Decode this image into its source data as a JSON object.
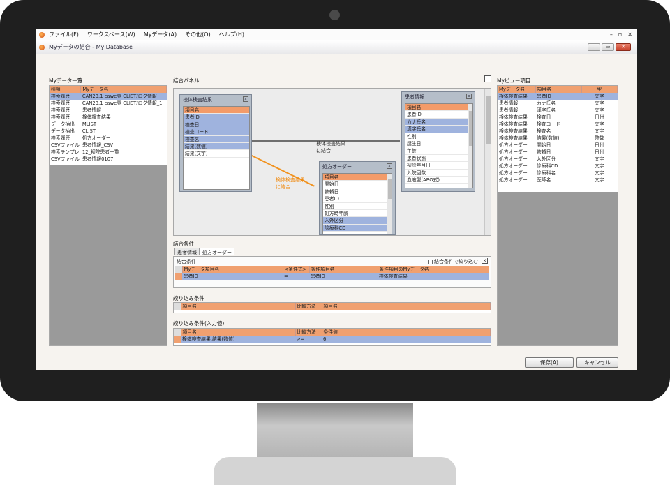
{
  "menu": {
    "items": [
      "ファイル(F)",
      "ワークスペース(W)",
      "Myデータ(A)",
      "その他(O)",
      "ヘルプ(H)"
    ],
    "controls": [
      "–",
      "▫",
      "✕"
    ]
  },
  "window": {
    "title": "Myデータの結合 - My Database",
    "buttons": [
      "–",
      "▭",
      "✕"
    ]
  },
  "mydata_list": {
    "label": "Myデータ一覧",
    "columns": [
      "種類",
      "Myデータ名"
    ],
    "rows": [
      [
        "検索履歴",
        "CAN23.1 cawe登 CLIST/ログ情報"
      ],
      [
        "検索履歴",
        "CAN23.1 cawe登 CLIST/ログ情報_1"
      ],
      [
        "検索履歴",
        "患者情報"
      ],
      [
        "検索履歴",
        "検体検査結果"
      ],
      [
        "データ抽出",
        "MLIST"
      ],
      [
        "データ抽出",
        "CLIST"
      ],
      [
        "検索履歴",
        "処方オーダー"
      ],
      [
        "CSVファイル",
        "患者情報_CSV"
      ],
      [
        "検索テンプレ",
        "12_初院患者一覧"
      ],
      [
        "CSVファイル",
        "患者情報0107"
      ]
    ],
    "selected_index": 0
  },
  "join_panel": {
    "label": "結合パネル",
    "join_label_top": "検体検査結果\nに結合",
    "join_label_left": "検体検査結果\nに結合",
    "tables": {
      "kentai": {
        "title": "検体検査結果",
        "fields": [
          "項目名",
          "患者ID",
          "検査日",
          "検査コード",
          "検査名",
          "結果(数値)",
          "結果(文字)"
        ]
      },
      "kanja": {
        "title": "患者情報",
        "fields": [
          "項目名",
          "患者ID",
          "カナ氏名",
          "漢字氏名",
          "性別",
          "誕生日",
          "年齢",
          "患者状態",
          "初診年月日",
          "入院回数",
          "血液型(ABO式)"
        ]
      },
      "shohou": {
        "title": "処方オーダー",
        "fields": [
          "項目名",
          "開始日",
          "依頼日",
          "患者ID",
          "性別",
          "処方時年齢",
          "入外区分",
          "診療科CD"
        ]
      }
    }
  },
  "join_conditions": {
    "label": "結合条件",
    "tabs": [
      "患者情報",
      "処方オーダー"
    ],
    "inner_label": "結合条件",
    "checkbox_label": "結合条件で絞り込む",
    "columns": [
      "Myデータ項目名",
      "<条件式>",
      "条件項目名",
      "条件項目のMyデータ名"
    ],
    "rows": [
      [
        "患者ID",
        "=",
        "患者ID",
        "検体検査結果"
      ]
    ]
  },
  "filter": {
    "label": "絞り込み条件",
    "columns": [
      "項目名",
      "比較方法",
      "項目名"
    ]
  },
  "filter_input": {
    "label": "絞り込み条件(入力値)",
    "columns": [
      "項目名",
      "比較方法",
      "条件値"
    ],
    "rows": [
      [
        "検体検査結果.結果(数値)",
        ">=",
        "6"
      ]
    ]
  },
  "myview": {
    "label": "Myビュー項目",
    "columns": [
      "Myデータ名",
      "項目名",
      "型"
    ],
    "rows": [
      [
        "検体検査結果",
        "患者ID",
        "文字"
      ],
      [
        "患者情報",
        "カナ氏名",
        "文字"
      ],
      [
        "患者情報",
        "漢字氏名",
        "文字"
      ],
      [
        "検体検査結果",
        "検査日",
        "日付"
      ],
      [
        "検体検査結果",
        "検査コード",
        "文字"
      ],
      [
        "検体検査結果",
        "検査名",
        "文字"
      ],
      [
        "検体検査結果",
        "結果(数値)",
        "整数"
      ],
      [
        "処方オーダー",
        "開始日",
        "日付"
      ],
      [
        "処方オーダー",
        "依頼日",
        "日付"
      ],
      [
        "処方オーダー",
        "入外区分",
        "文字"
      ],
      [
        "処方オーダー",
        "診療科CD",
        "文字"
      ],
      [
        "処方オーダー",
        "診療科名",
        "文字"
      ],
      [
        "処方オーダー",
        "医師名",
        "文字"
      ]
    ],
    "selected_index": 0
  },
  "footer": {
    "save": "保存(A)",
    "cancel": "キャンセル"
  }
}
